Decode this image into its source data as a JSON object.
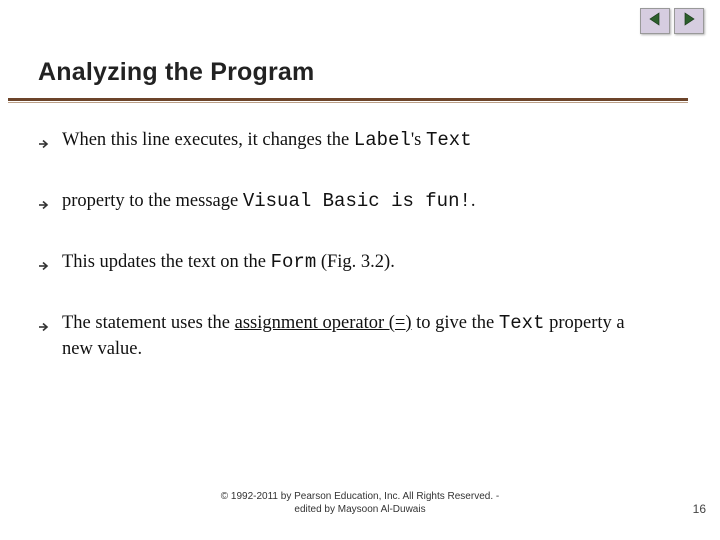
{
  "nav": {
    "prev_icon": "triangle-left",
    "next_icon": "triangle-right"
  },
  "title": "Analyzing the Program",
  "bullets": [
    {
      "parts": [
        {
          "text": "When this line executes, it changes the ",
          "style": "normal"
        },
        {
          "text": "Label",
          "style": "mono"
        },
        {
          "text": "'s ",
          "style": "normal"
        },
        {
          "text": "Text",
          "style": "mono"
        }
      ]
    },
    {
      "parts": [
        {
          "text": " property to the message ",
          "style": "normal"
        },
        {
          "text": "Visual Basic is fun!",
          "style": "mono"
        },
        {
          "text": ".",
          "style": "normal"
        }
      ]
    },
    {
      "parts": [
        {
          "text": "This updates the text on the ",
          "style": "normal"
        },
        {
          "text": "Form",
          "style": "mono"
        },
        {
          "text": " (Fig. 3.2).",
          "style": "normal"
        }
      ]
    },
    {
      "parts": [
        {
          "text": "The statement uses the ",
          "style": "normal"
        },
        {
          "text": "assignment operator (=)",
          "style": "underline"
        },
        {
          "text": " to give the ",
          "style": "normal"
        },
        {
          "text": "Text",
          "style": "mono"
        },
        {
          "text": " property a new value.",
          "style": "normal"
        }
      ]
    }
  ],
  "copyright_line1": "© 1992-2011 by Pearson Education, Inc. All Rights Reserved. -",
  "copyright_line2": "edited by Maysoon Al-Duwais",
  "page_number": "16"
}
